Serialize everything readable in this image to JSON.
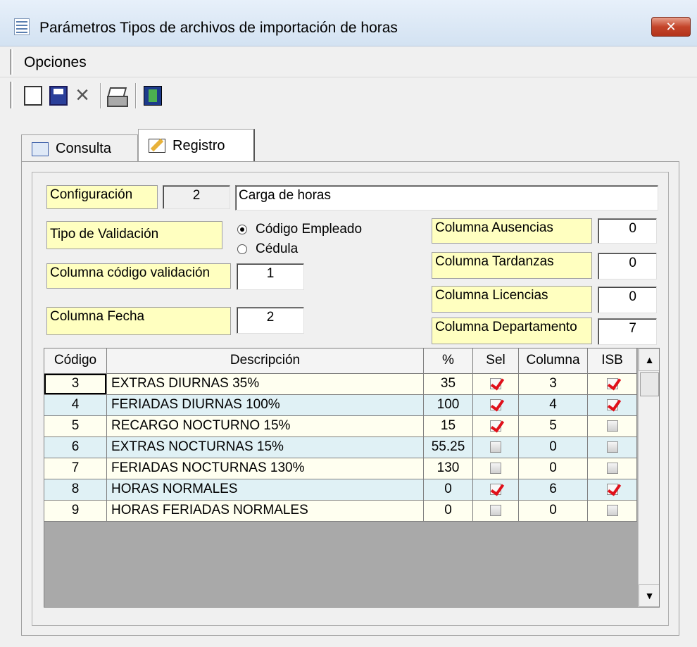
{
  "window": {
    "title": "Parámetros Tipos de archivos de importación de horas",
    "close_label": "✕"
  },
  "menu": {
    "items": [
      {
        "label": "Opciones"
      }
    ]
  },
  "toolbar": {
    "icons": [
      "new-document-icon",
      "save-icon",
      "delete-icon",
      "print-icon",
      "exit-icon"
    ]
  },
  "tabs": [
    {
      "label": "Consulta",
      "icon": "grid-icon"
    },
    {
      "label": "Registro",
      "icon": "edit-icon"
    }
  ],
  "form": {
    "configuracion_label": "Configuración",
    "configuracion_id": "2",
    "configuracion_name": "Carga de horas",
    "tipo_validacion_label": "Tipo de Validación",
    "radio_options": [
      {
        "label": "Código Empleado",
        "selected": true
      },
      {
        "label": "Cédula",
        "selected": false
      }
    ],
    "col_codigo_label": "Columna código validación",
    "col_codigo_value": "1",
    "col_fecha_label": "Columna Fecha",
    "col_fecha_value": "2",
    "col_ausencias_label": "Columna Ausencias",
    "col_ausencias_value": "0",
    "col_tardanzas_label": "Columna Tardanzas",
    "col_tardanzas_value": "0",
    "col_licencias_label": "Columna Licencias",
    "col_licencias_value": "0",
    "col_departamento_label": "Columna Departamento",
    "col_departamento_value": "7"
  },
  "grid": {
    "headers": [
      "Código",
      "Descripción",
      "%",
      "Sel",
      "Columna",
      "ISB"
    ],
    "rows": [
      {
        "codigo": "3",
        "descripcion": "EXTRAS DIURNAS 35%",
        "pct": "35",
        "sel": true,
        "columna": "3",
        "isb": true
      },
      {
        "codigo": "4",
        "descripcion": "FERIADAS DIURNAS 100%",
        "pct": "100",
        "sel": true,
        "columna": "4",
        "isb": true
      },
      {
        "codigo": "5",
        "descripcion": "RECARGO NOCTURNO 15%",
        "pct": "15",
        "sel": true,
        "columna": "5",
        "isb": false
      },
      {
        "codigo": "6",
        "descripcion": "EXTRAS NOCTURNAS 15%",
        "pct": "55.25",
        "sel": false,
        "columna": "0",
        "isb": false
      },
      {
        "codigo": "7",
        "descripcion": "FERIADAS NOCTURNAS 130%",
        "pct": "130",
        "sel": false,
        "columna": "0",
        "isb": false
      },
      {
        "codigo": "8",
        "descripcion": "HORAS NORMALES",
        "pct": "0",
        "sel": true,
        "columna": "6",
        "isb": true
      },
      {
        "codigo": "9",
        "descripcion": "HORAS FERIADAS NORMALES",
        "pct": "0",
        "sel": false,
        "columna": "0",
        "isb": false
      }
    ]
  },
  "colors": {
    "label_bg": "#ffffc0",
    "row_odd": "#fffff0",
    "row_even": "#e0f1f5",
    "check_red": "#e0101a"
  }
}
